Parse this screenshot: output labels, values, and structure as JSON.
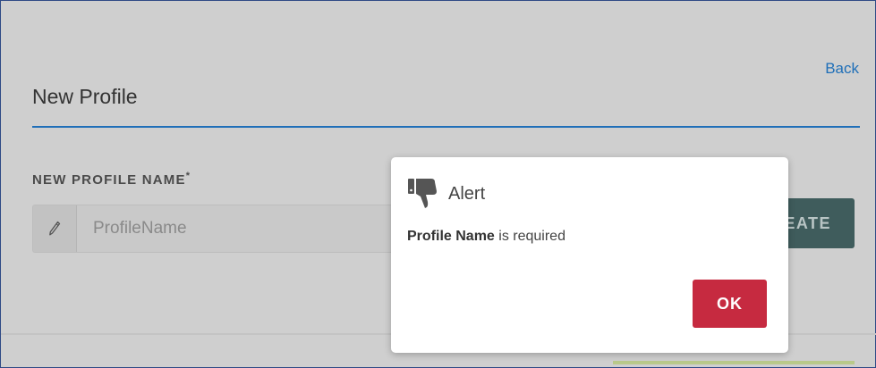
{
  "header": {
    "back_label": "Back",
    "title": "New Profile"
  },
  "form": {
    "label": "NEW PROFILE NAME",
    "required_marker": "*",
    "placeholder": "ProfileName",
    "value": "",
    "create_label": "EATE"
  },
  "icons": {
    "input": "pencil-icon",
    "alert": "thumbs-down-icon"
  },
  "alert": {
    "title": "Alert",
    "message_field": "Profile Name",
    "message_rest": " is required",
    "ok_label": "OK"
  },
  "colors": {
    "accent": "#1f6fb8",
    "ok_button": "#c62a40",
    "create_button": "#3f5c5c"
  }
}
